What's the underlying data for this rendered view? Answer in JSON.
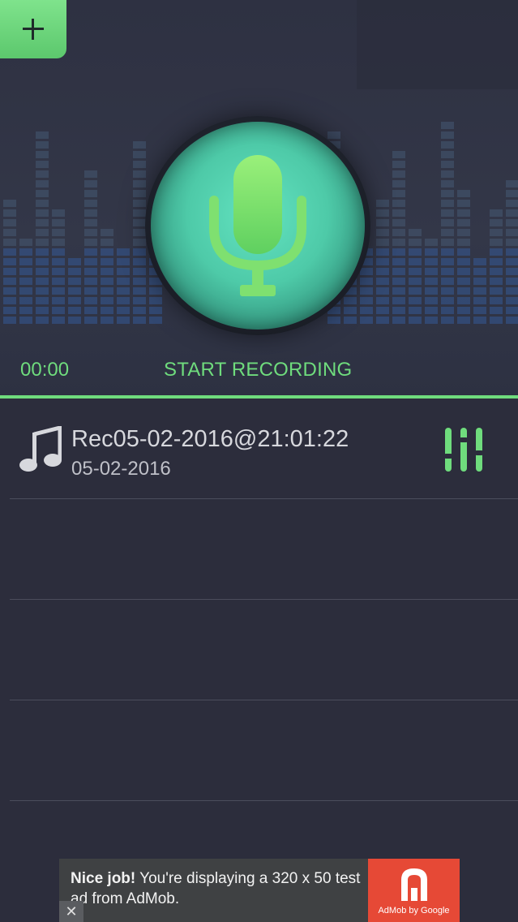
{
  "header": {
    "timer": "00:00",
    "start_label": "START RECORDING",
    "add_icon": "plus-icon",
    "mic_icon": "microphone-icon"
  },
  "recordings": [
    {
      "title": "Rec05-02-2016@21:01:22",
      "date": "05-02-2016",
      "icon": "music-note-icon",
      "action_icon": "equalizer-icon"
    }
  ],
  "ad": {
    "bold": "Nice job!",
    "text": " You're displaying a 320 x 50 test ad from AdMob.",
    "logo_label": "AdMob by Google",
    "close_icon": "close-icon"
  },
  "colors": {
    "accent": "#6fdc7d",
    "background": "#2c2d3c",
    "mic": "#4ecaa8",
    "ad_logo": "#e64936"
  }
}
